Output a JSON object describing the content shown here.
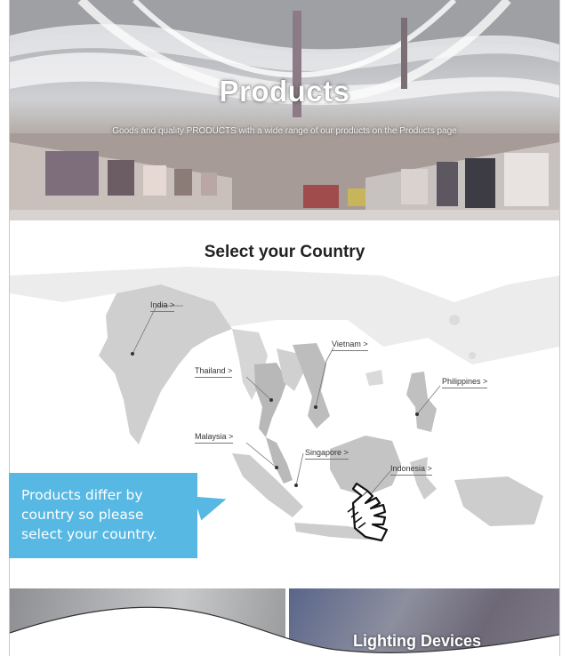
{
  "hero": {
    "title": "Products",
    "subtitle": "Goods and quality PRODUCTS with a wide range of our products on the Products page"
  },
  "select": {
    "heading": "Select your Country"
  },
  "countries": [
    {
      "key": "india",
      "label": "India >"
    },
    {
      "key": "vietnam",
      "label": "Vietnam >"
    },
    {
      "key": "thailand",
      "label": "Thailand >"
    },
    {
      "key": "philippines",
      "label": "Philippines >"
    },
    {
      "key": "malaysia",
      "label": "Malaysia >"
    },
    {
      "key": "singapore",
      "label": "Singapore >"
    },
    {
      "key": "indonesia",
      "label": "Indonesia >"
    }
  ],
  "callout": {
    "line1": "Products differ by",
    "line2": "country so please",
    "line3": "select your country."
  },
  "categories": [
    {
      "label": ""
    },
    {
      "label": "Lighting Devices"
    }
  ],
  "icons": {
    "pointer": "hand-pointer-icon"
  },
  "colors": {
    "callout": "#56b8e3",
    "map_land": "#cfcfcf",
    "map_highlight": "#b8b8b8"
  }
}
